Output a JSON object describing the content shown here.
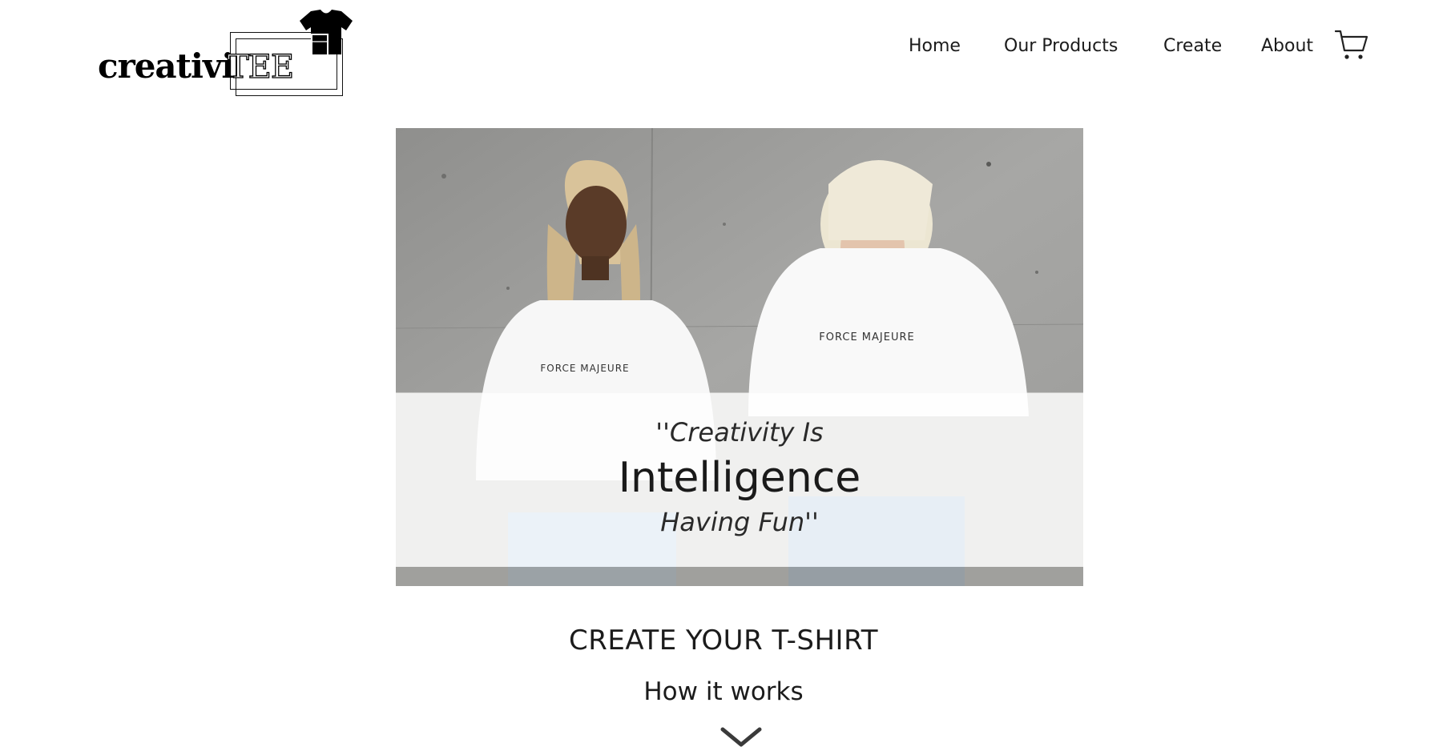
{
  "brand": {
    "logo_prefix": "creativi",
    "logo_suffix": "TEE",
    "logo_icon": "tshirt-icon"
  },
  "nav": {
    "items": [
      {
        "label": "Home"
      },
      {
        "label": "Our Products"
      },
      {
        "label": "Create"
      },
      {
        "label": "About"
      }
    ],
    "cart_icon": "cart-icon"
  },
  "hero": {
    "shirt_print": "FORCE MAJEURE",
    "quote_line1": "''Creativity Is",
    "quote_line2": "Intelligence",
    "quote_line3": "Having Fun''"
  },
  "section": {
    "title": "CREATE YOUR T-SHIRT",
    "subtitle": "How it works",
    "scroll_icon": "chevron-down-icon"
  },
  "colors": {
    "text": "#1b1b1b",
    "background": "#ffffff",
    "band": "#ffffff"
  }
}
